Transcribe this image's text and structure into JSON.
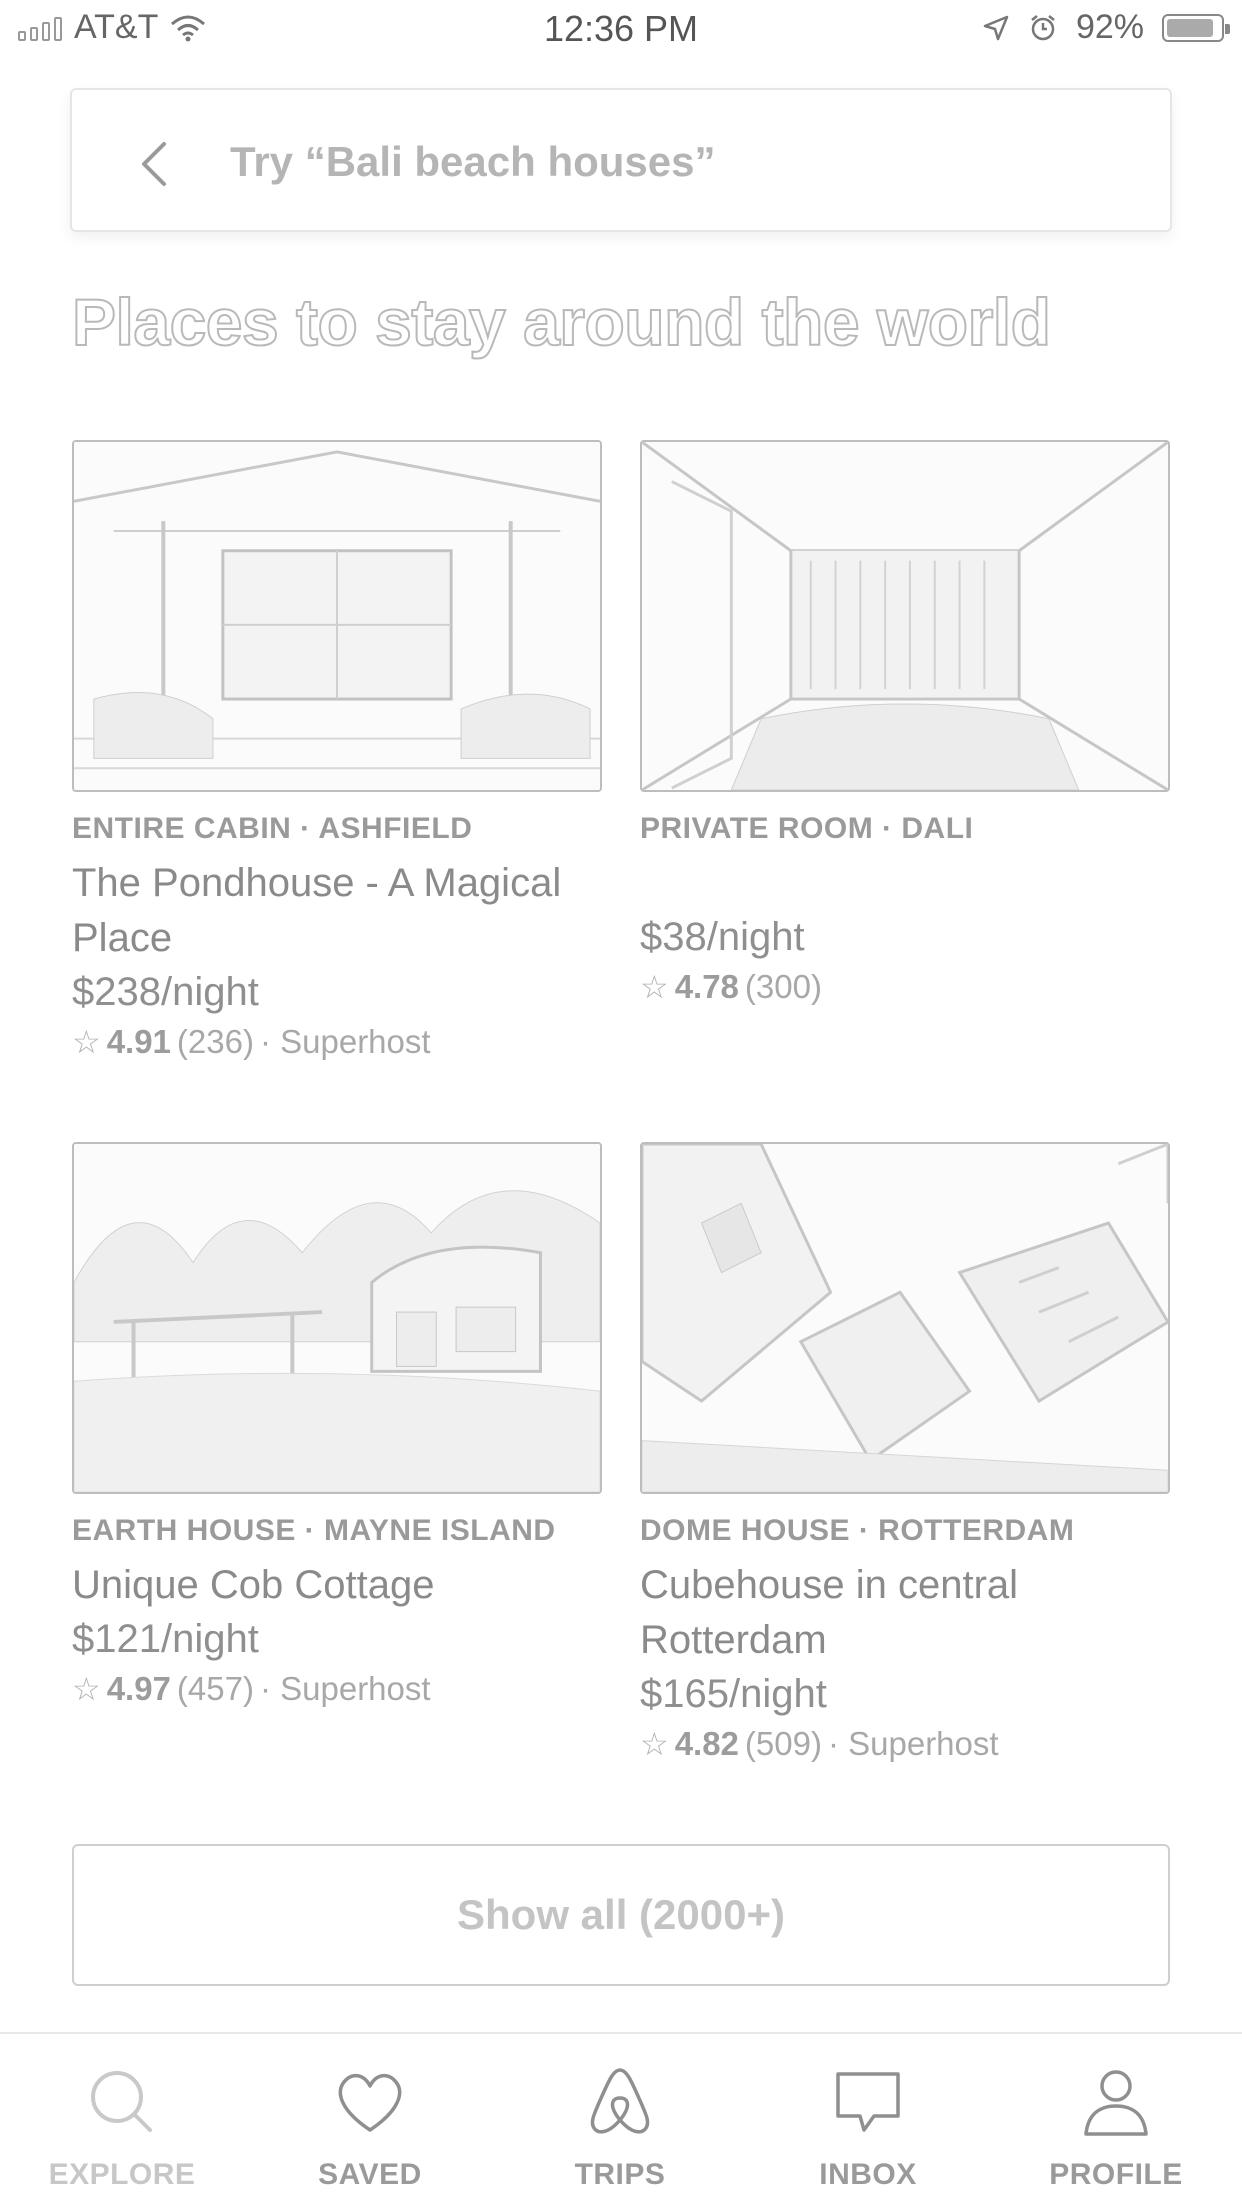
{
  "status_bar": {
    "carrier": "AT&T",
    "time": "12:36 PM",
    "battery": "92%",
    "battery_level": 0.92
  },
  "search": {
    "placeholder": "Try “Bali beach houses”"
  },
  "section": {
    "title": "Places to stay around the world"
  },
  "listings": [
    {
      "meta": "ENTIRE CABIN · ASHFIELD",
      "title": "The Pondhouse - A Magical Place",
      "price": "$238/night",
      "rating": "4.91",
      "reviews": "(236)",
      "badge": "· Superhost",
      "image_icon": "cabin-interior-photo"
    },
    {
      "meta": "PRIVATE ROOM · DALI",
      "title": "",
      "price": "$38/night",
      "rating": "4.78",
      "reviews": "(300)",
      "badge": "",
      "image_icon": "room-interior-photo"
    },
    {
      "meta": "EARTH HOUSE · MAYNE ISLAND",
      "title": "Unique Cob Cottage",
      "price": "$121/night",
      "rating": "4.97",
      "reviews": "(457)",
      "badge": "· Superhost",
      "image_icon": "cottage-exterior-photo"
    },
    {
      "meta": "DOME HOUSE · ROTTERDAM",
      "title": "Cubehouse in central Rotterdam",
      "price": "$165/night",
      "rating": "4.82",
      "reviews": "(509)",
      "badge": "· Superhost",
      "image_icon": "cube-houses-photo"
    }
  ],
  "show_all": {
    "label": "Show all (2000+)"
  },
  "tabs": [
    {
      "label": "EXPLORE",
      "icon": "search-icon",
      "active": true
    },
    {
      "label": "SAVED",
      "icon": "heart-icon",
      "active": false
    },
    {
      "label": "TRIPS",
      "icon": "airbnb-logo-icon",
      "active": false
    },
    {
      "label": "INBOX",
      "icon": "chat-bubble-icon",
      "active": false
    },
    {
      "label": "PROFILE",
      "icon": "person-icon",
      "active": false
    }
  ]
}
